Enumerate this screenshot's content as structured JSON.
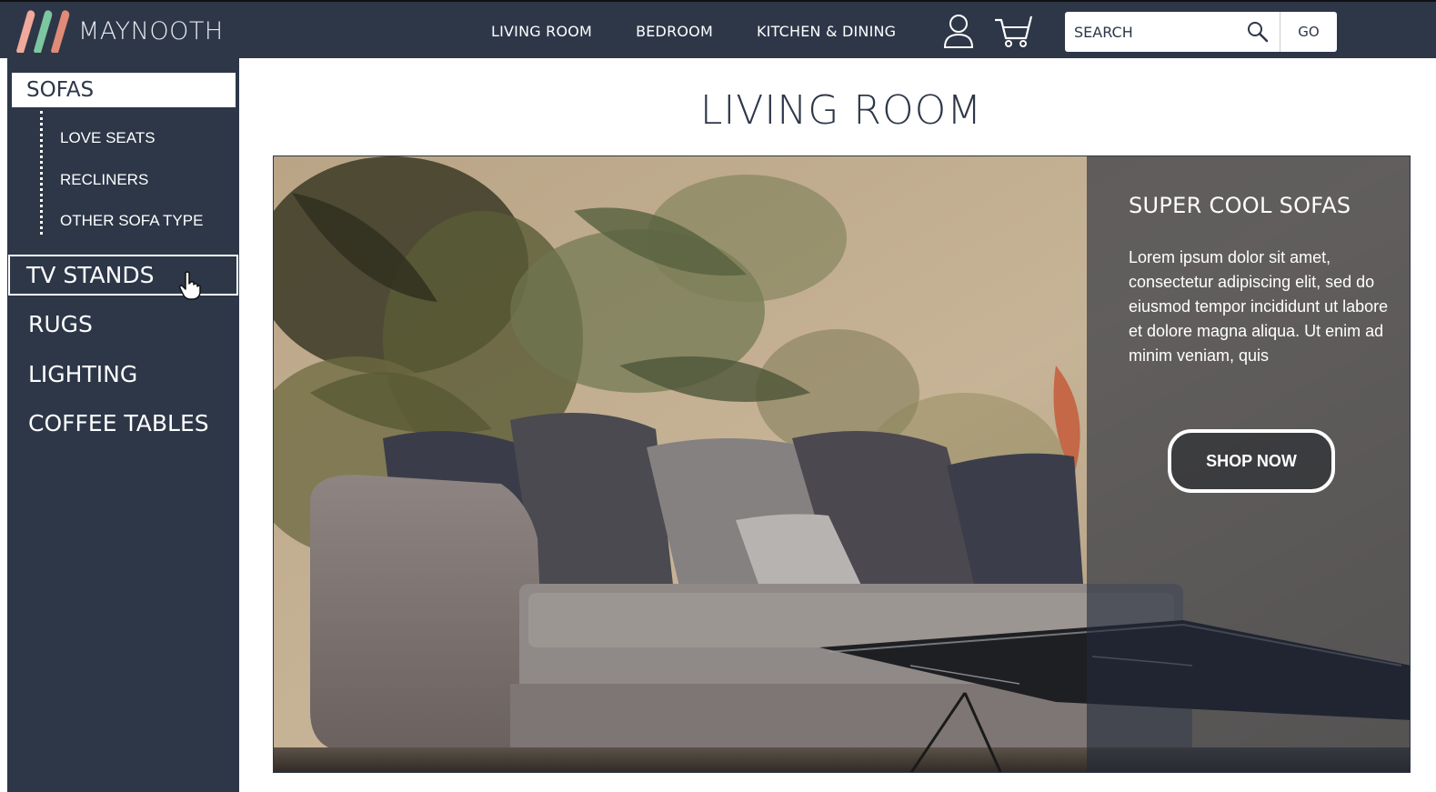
{
  "brand": {
    "name": "MAYNOOTH",
    "colors": {
      "primary": "#2d3748",
      "stripe1": "#f0a99a",
      "stripe2": "#7cc6a0",
      "stripe3": "#e08a78"
    }
  },
  "header": {
    "nav": [
      "LIVING ROOM",
      "BEDROOM",
      "KITCHEN & DINING"
    ],
    "icons": [
      "user-icon",
      "cart-icon"
    ],
    "search": {
      "placeholder": "SEARCH",
      "value": "",
      "button": "GO"
    }
  },
  "sidebar": {
    "active": "SOFAS",
    "subitems": [
      "LOVE SEATS",
      "RECLINERS",
      "OTHER SOFA TYPE"
    ],
    "hovered": "TV STANDS",
    "items": [
      "RUGS",
      "LIGHTING",
      "COFFEE TABLES"
    ]
  },
  "main": {
    "title": "LIVING ROOM",
    "promo": {
      "title": "SUPER COOL SOFAS",
      "body": "Lorem ipsum dolor sit amet, consectetur adipiscing elit, sed do eiusmod tempor incididunt ut labore et dolore magna aliqua. Ut enim ad minim veniam, quis",
      "button": "SHOP NOW"
    }
  }
}
